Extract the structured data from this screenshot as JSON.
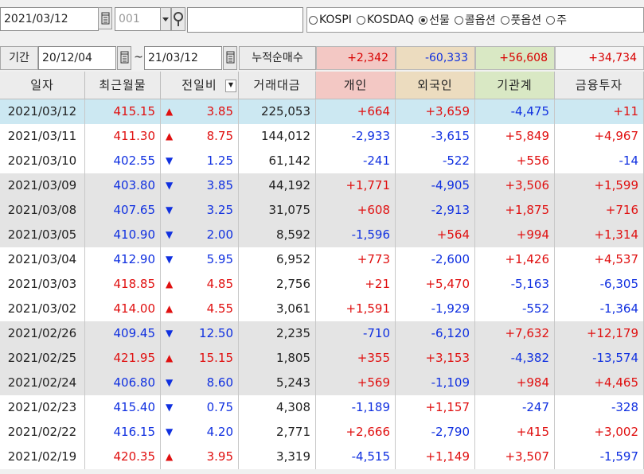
{
  "top": {
    "date_value": "2021/03/12",
    "code_value": "001",
    "radios": [
      {
        "label": "KOSPI",
        "selected": false
      },
      {
        "label": "KOSDAQ",
        "selected": false
      },
      {
        "label": "선물",
        "selected": true
      },
      {
        "label": "콜옵션",
        "selected": false
      },
      {
        "label": "풋옵션",
        "selected": false
      },
      {
        "label": "주",
        "selected": false
      }
    ]
  },
  "period": {
    "label": "기간",
    "from": "20/12/04",
    "tilde": "~",
    "to": "21/03/12",
    "cum_label": "누적순매수",
    "cum_values": [
      "+2,342",
      "-60,333",
      "+56,608",
      "+34,734"
    ]
  },
  "columns": [
    "일자",
    "최근월물",
    "전일비",
    "거래대금",
    "개인",
    "외국인",
    "기관계",
    "금융투자"
  ],
  "rows": [
    {
      "date": "2021/03/12",
      "price": "415.15",
      "dir": "up",
      "chg": "3.85",
      "amount": "225,053",
      "ind": "+664",
      "frn": "+3,659",
      "inst": "-4,475",
      "fin": "+11"
    },
    {
      "date": "2021/03/11",
      "price": "411.30",
      "dir": "up",
      "chg": "8.75",
      "amount": "144,012",
      "ind": "-2,933",
      "frn": "-3,615",
      "inst": "+5,849",
      "fin": "+4,967"
    },
    {
      "date": "2021/03/10",
      "price": "402.55",
      "dir": "down",
      "chg": "1.25",
      "amount": "61,142",
      "ind": "-241",
      "frn": "-522",
      "inst": "+556",
      "fin": "-14"
    },
    {
      "date": "2021/03/09",
      "price": "403.80",
      "dir": "down",
      "chg": "3.85",
      "amount": "44,192",
      "ind": "+1,771",
      "frn": "-4,905",
      "inst": "+3,506",
      "fin": "+1,599"
    },
    {
      "date": "2021/03/08",
      "price": "407.65",
      "dir": "down",
      "chg": "3.25",
      "amount": "31,075",
      "ind": "+608",
      "frn": "-2,913",
      "inst": "+1,875",
      "fin": "+716"
    },
    {
      "date": "2021/03/05",
      "price": "410.90",
      "dir": "down",
      "chg": "2.00",
      "amount": "8,592",
      "ind": "-1,596",
      "frn": "+564",
      "inst": "+994",
      "fin": "+1,314"
    },
    {
      "date": "2021/03/04",
      "price": "412.90",
      "dir": "down",
      "chg": "5.95",
      "amount": "6,952",
      "ind": "+773",
      "frn": "-2,600",
      "inst": "+1,426",
      "fin": "+4,537"
    },
    {
      "date": "2021/03/03",
      "price": "418.85",
      "dir": "up",
      "chg": "4.85",
      "amount": "2,756",
      "ind": "+21",
      "frn": "+5,470",
      "inst": "-5,163",
      "fin": "-6,305"
    },
    {
      "date": "2021/03/02",
      "price": "414.00",
      "dir": "up",
      "chg": "4.55",
      "amount": "3,061",
      "ind": "+1,591",
      "frn": "-1,929",
      "inst": "-552",
      "fin": "-1,364"
    },
    {
      "date": "2021/02/26",
      "price": "409.45",
      "dir": "down",
      "chg": "12.50",
      "amount": "2,235",
      "ind": "-710",
      "frn": "-6,120",
      "inst": "+7,632",
      "fin": "+12,179"
    },
    {
      "date": "2021/02/25",
      "price": "421.95",
      "dir": "up",
      "chg": "15.15",
      "amount": "1,805",
      "ind": "+355",
      "frn": "+3,153",
      "inst": "-4,382",
      "fin": "-13,574"
    },
    {
      "date": "2021/02/24",
      "price": "406.80",
      "dir": "down",
      "chg": "8.60",
      "amount": "5,243",
      "ind": "+569",
      "frn": "-1,109",
      "inst": "+984",
      "fin": "+4,465"
    },
    {
      "date": "2021/02/23",
      "price": "415.40",
      "dir": "down",
      "chg": "0.75",
      "amount": "4,308",
      "ind": "-1,189",
      "frn": "+1,157",
      "inst": "-247",
      "fin": "-328"
    },
    {
      "date": "2021/02/22",
      "price": "416.15",
      "dir": "down",
      "chg": "4.20",
      "amount": "2,771",
      "ind": "+2,666",
      "frn": "-2,790",
      "inst": "+415",
      "fin": "+3,002"
    },
    {
      "date": "2021/02/19",
      "price": "420.35",
      "dir": "up",
      "chg": "3.95",
      "amount": "3,319",
      "ind": "-4,515",
      "frn": "+1,149",
      "inst": "+3,507",
      "fin": "-1,597"
    }
  ],
  "colors": {
    "selected_row": "#cce8f2",
    "group_gray": "#e4e4e4",
    "white": "#ffffff",
    "hdr_individual": "#f3c8c4",
    "hdr_foreign": "#ecdcbf",
    "hdr_institution": "#d9e8c4",
    "hdr_financial": "#ececec",
    "up": "#e01010",
    "down": "#1030e0"
  }
}
